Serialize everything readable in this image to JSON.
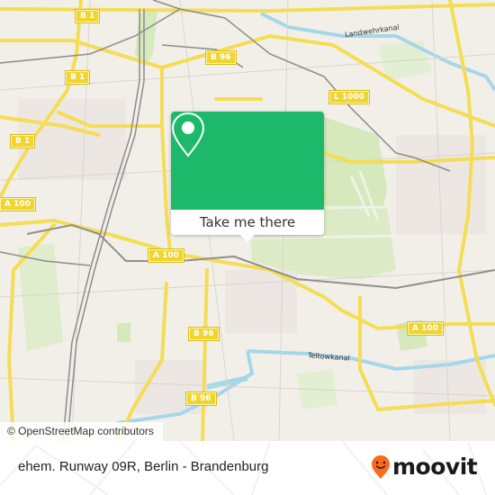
{
  "map": {
    "road_labels": [
      {
        "id": "b1-top",
        "text": "B 1"
      },
      {
        "id": "b1-mid",
        "text": "B 1"
      },
      {
        "id": "b1-left",
        "text": "B 1"
      },
      {
        "id": "b96-top",
        "text": "B 96"
      },
      {
        "id": "l1000",
        "text": "L 1000"
      },
      {
        "id": "a100-left",
        "text": "A 100"
      },
      {
        "id": "a100-mid",
        "text": "A 100"
      },
      {
        "id": "a100-right",
        "text": "A 100"
      },
      {
        "id": "b96-mid",
        "text": "B 96"
      },
      {
        "id": "b96-bottom",
        "text": "B 96"
      }
    ],
    "water_labels": {
      "landwehrkanal": "Landwehrkanal",
      "teltowkanal": "Teltowkanal"
    },
    "colors": {
      "land": "#f2efe9",
      "park": "#d4e8b8",
      "water": "#9fd3e8",
      "major_road": "#f6e25a",
      "rail": "#8a8a8a"
    }
  },
  "popup": {
    "icon": "location-pin-icon",
    "button_label": "Take me there",
    "color": "#1db96b"
  },
  "attribution": "© OpenStreetMap contributors",
  "footer": {
    "place_name": "ehem. Runway 09R, Berlin - Brandenburg",
    "brand": "moovit",
    "brand_color": "#f96a1f"
  }
}
